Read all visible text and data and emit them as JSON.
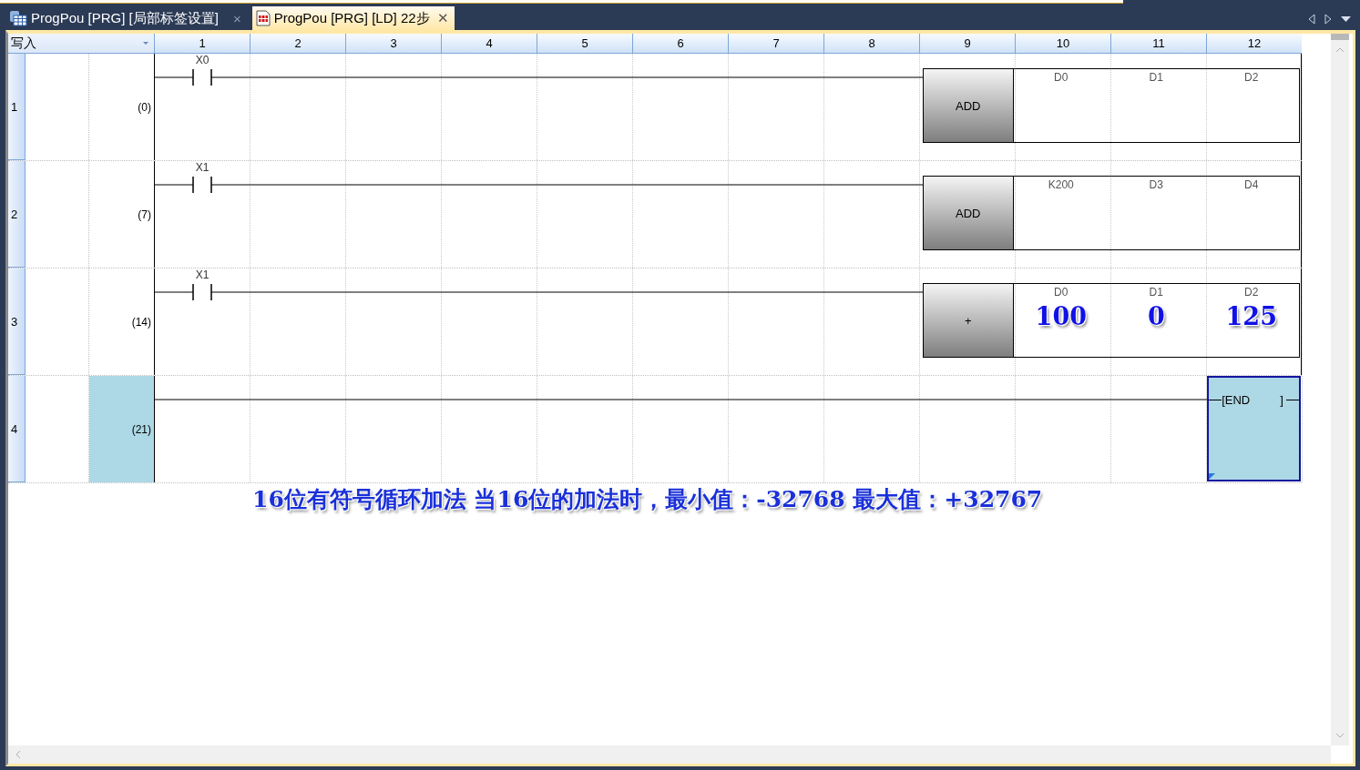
{
  "tabs": [
    {
      "label": "ProgPou [PRG] [局部标签设置]",
      "kind": "labels",
      "selected": false,
      "close": "×"
    },
    {
      "label": "ProgPou [PRG] [LD] 22步",
      "kind": "ladder",
      "selected": true,
      "close": "✕"
    }
  ],
  "ladder": {
    "mode": "写入",
    "columns": [
      "1",
      "2",
      "3",
      "4",
      "5",
      "6",
      "7",
      "8",
      "9",
      "10",
      "11",
      "12"
    ],
    "rungs": [
      {
        "number": "1",
        "step": "(0)",
        "selected": false,
        "kind": "instruction",
        "contact": "X0",
        "instruction": "ADD",
        "operands": [
          {
            "label": "D0"
          },
          {
            "label": "D1"
          },
          {
            "label": "D2"
          }
        ]
      },
      {
        "number": "2",
        "step": "(7)",
        "selected": false,
        "kind": "instruction",
        "contact": "X1",
        "instruction": "ADD",
        "operands": [
          {
            "label": "K200"
          },
          {
            "label": "D3"
          },
          {
            "label": "D4"
          }
        ]
      },
      {
        "number": "3",
        "step": "(14)",
        "selected": false,
        "kind": "instruction",
        "contact": "X1",
        "instruction": "+",
        "operands": [
          {
            "label": "D0",
            "value": "100"
          },
          {
            "label": "D1",
            "value": "0"
          },
          {
            "label": "D2",
            "value": "125"
          }
        ]
      },
      {
        "number": "4",
        "step": "(21)",
        "selected": true,
        "kind": "end",
        "instruction": "[END",
        "close": "]"
      }
    ]
  },
  "caption": "16位有符号循环加法 当16位的加法时，最小值：-32768  最大值：+32767"
}
